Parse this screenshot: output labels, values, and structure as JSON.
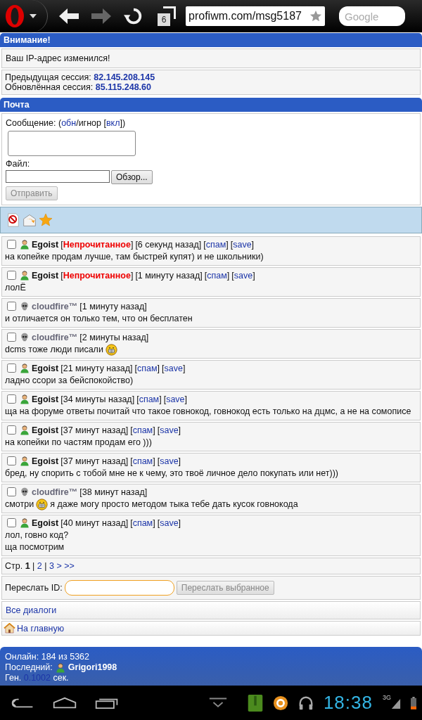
{
  "browser": {
    "tab_count": "6",
    "url": "profiwm.com/msg5187",
    "search_placeholder": "Google"
  },
  "notice": {
    "title": "Внимание!",
    "message": "Ваш IP-адрес изменился!",
    "sessions": [
      {
        "label": "Предыдущая сессия: ",
        "ip": "82.145.208.145"
      },
      {
        "label": "Обновлённая сессия: ",
        "ip": "85.115.248.60"
      }
    ]
  },
  "mail": {
    "title": "Почта",
    "message_label": [
      {
        "kind": "text",
        "text": "Сообщение: ("
      },
      {
        "kind": "link",
        "text": "обн"
      },
      {
        "kind": "text",
        "text": "/игнор ["
      },
      {
        "kind": "link",
        "text": "вкл"
      },
      {
        "kind": "text",
        "text": "])"
      }
    ],
    "file_label": "Файл:",
    "browse_button": "Обзор...",
    "send_button": "Отправить",
    "send_disabled": true
  },
  "toolbar": [
    {
      "kind": "block"
    },
    {
      "kind": "mail"
    },
    {
      "kind": "star"
    }
  ],
  "messages": [
    {
      "checked": false,
      "user": "Egoist",
      "kind": "member",
      "unread": {
        "before": "[",
        "label": "Непрочитанное",
        "after": "]"
      },
      "time": "[6 секунд назад]",
      "links": [
        {
          "before": "[",
          "label": "спам",
          "after": "]"
        },
        {
          "before": "[",
          "label": "save",
          "after": "]"
        }
      ],
      "lines": [
        [
          {
            "kind": "text",
            "text": "на копейке продам лучше, там быстрей купят) и не школьники)"
          }
        ]
      ]
    },
    {
      "checked": false,
      "user": "Egoist",
      "kind": "member",
      "unread": {
        "before": "[",
        "label": "Непрочитанное",
        "after": "]"
      },
      "time": "[1 минуту назад]",
      "links": [
        {
          "before": "[",
          "label": "спам",
          "after": "]"
        },
        {
          "before": "[",
          "label": "save",
          "after": "]"
        }
      ],
      "lines": [
        [
          {
            "kind": "text",
            "text": "лолЁ"
          }
        ]
      ]
    },
    {
      "checked": false,
      "user": "cloudfire™",
      "kind": "dead",
      "time": "[1 минуту назад]",
      "lines": [
        [
          {
            "kind": "text",
            "text": "и отличается он только тем, что он бесплатен"
          }
        ]
      ]
    },
    {
      "checked": false,
      "user": "cloudfire™",
      "kind": "dead",
      "time": "[2 минуты назад]",
      "lines": [
        [
          {
            "kind": "text",
            "text": "dcms тоже люди писали"
          },
          {
            "kind": "smiley"
          }
        ]
      ]
    },
    {
      "checked": false,
      "user": "Egoist",
      "kind": "member",
      "time": "[21 минуту назад]",
      "links": [
        {
          "before": "[",
          "label": "спам",
          "after": "]"
        },
        {
          "before": "[",
          "label": "save",
          "after": "]"
        }
      ],
      "lines": [
        [
          {
            "kind": "text",
            "text": "ладно ссори за бейспокойство)"
          }
        ]
      ]
    },
    {
      "checked": false,
      "user": "Egoist",
      "kind": "member",
      "time": "[34 минуты назад]",
      "links": [
        {
          "before": "[",
          "label": "спам",
          "after": "]"
        },
        {
          "before": "[",
          "label": "save",
          "after": "]"
        }
      ],
      "lines": [
        [
          {
            "kind": "text",
            "text": "ща на форуме ответы почитай что такое говнокод, говнокод есть только на дцмс, а не на сомописе"
          }
        ]
      ]
    },
    {
      "checked": false,
      "user": "Egoist",
      "kind": "member",
      "time": "[37 минут назад]",
      "links": [
        {
          "before": "[",
          "label": "спам",
          "after": "]"
        },
        {
          "before": "[",
          "label": "save",
          "after": "]"
        }
      ],
      "lines": [
        [
          {
            "kind": "text",
            "text": "на копейки по частям продам его )))"
          }
        ]
      ]
    },
    {
      "checked": false,
      "user": "Egoist",
      "kind": "member",
      "time": "[37 минут назад]",
      "links": [
        {
          "before": "[",
          "label": "спам",
          "after": "]"
        },
        {
          "before": "[",
          "label": "save",
          "after": "]"
        }
      ],
      "lines": [
        [
          {
            "kind": "text",
            "text": "бред, ну спорить с тобой мне не к чему, это твоё личное дело покупать или нет)))"
          }
        ]
      ]
    },
    {
      "checked": false,
      "user": "cloudfire™",
      "kind": "dead",
      "time": "[38 минут назад]",
      "lines": [
        [
          {
            "kind": "text",
            "text": "смотри"
          },
          {
            "kind": "smiley"
          },
          {
            "kind": "text",
            "text": "я даже могу просто методом тыка тебе дать кусок говнокода"
          }
        ]
      ]
    },
    {
      "checked": false,
      "user": "Egoist",
      "kind": "member",
      "time": "[40 минут назад]",
      "links": [
        {
          "before": "[",
          "label": "спам",
          "after": "]"
        },
        {
          "before": "[",
          "label": "save",
          "after": "]"
        }
      ],
      "lines": [
        [
          {
            "kind": "text",
            "text": "лол, говно код?"
          }
        ],
        [
          {
            "kind": "text",
            "text": "ща посмотрим"
          }
        ]
      ]
    }
  ],
  "pagination": [
    {
      "kind": "text",
      "text": "Стр. "
    },
    {
      "kind": "bold",
      "text": "1"
    },
    {
      "kind": "text",
      "text": " | "
    },
    {
      "kind": "link",
      "text": "2"
    },
    {
      "kind": "text",
      "text": " | "
    },
    {
      "kind": "link",
      "text": "3"
    },
    {
      "kind": "link",
      "text": " > "
    },
    {
      "kind": "link",
      "text": ">>"
    }
  ],
  "forward": {
    "label": "Переслать ID:",
    "button": "Переслать выбранное",
    "button_disabled": true
  },
  "all_dialogs": "Все диалоги",
  "home_link": "На главную",
  "footer": {
    "online": "Онлайн: 184 из 5362",
    "last_label": "Последний:",
    "last_user": "Grigori1998",
    "gen_before": "Ген. ",
    "gen_value": "0.1002",
    "gen_after": " сек."
  },
  "status_bar": {
    "time": "18:38",
    "network": "3G"
  }
}
